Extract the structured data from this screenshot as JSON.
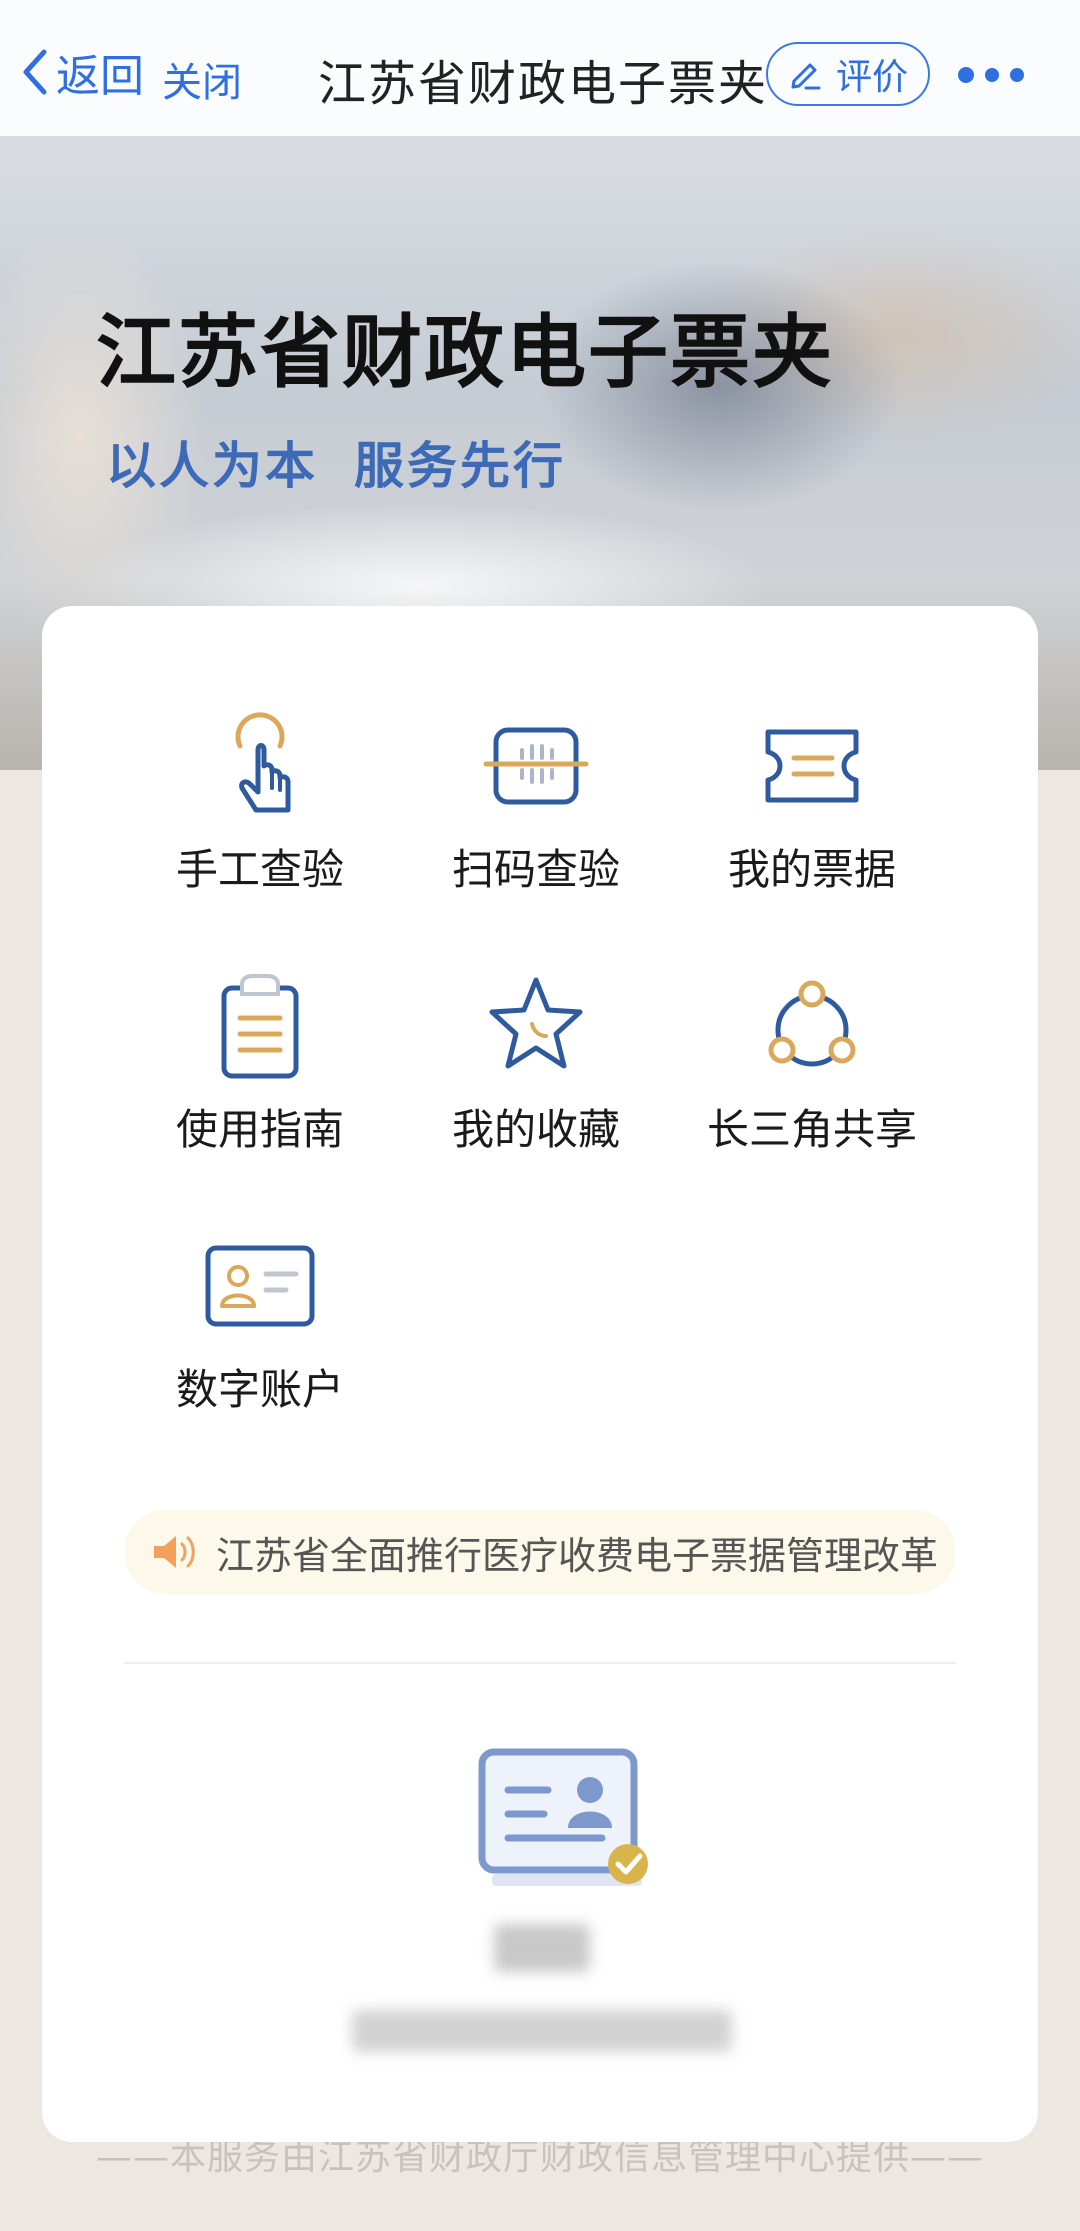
{
  "nav": {
    "back_label": "返回",
    "close_label": "关闭",
    "title": "江苏省财政电子票夹",
    "rate_label": "评价",
    "accent_color": "#2f6fe0"
  },
  "banner": {
    "title": "江苏省财政电子票夹",
    "slogan_1": "以人为本",
    "slogan_2": "服务先行"
  },
  "menu": {
    "items": [
      {
        "label": "手工查验",
        "icon": "hand-tap-icon"
      },
      {
        "label": "扫码查验",
        "icon": "scan-code-icon"
      },
      {
        "label": "我的票据",
        "icon": "ticket-icon"
      },
      {
        "label": "使用指南",
        "icon": "clipboard-icon"
      },
      {
        "label": "我的收藏",
        "icon": "star-icon"
      },
      {
        "label": "长三角共享",
        "icon": "share-network-icon"
      },
      {
        "label": "数字账户",
        "icon": "id-card-icon"
      }
    ]
  },
  "notice": {
    "icon": "speaker-icon",
    "text": "江苏省全面推行医疗收费电子票据管理改革"
  },
  "account": {
    "icon": "verified-id-card-icon"
  },
  "footer": {
    "text": "——本服务由江苏省财政厅财政信息管理中心提供——"
  }
}
